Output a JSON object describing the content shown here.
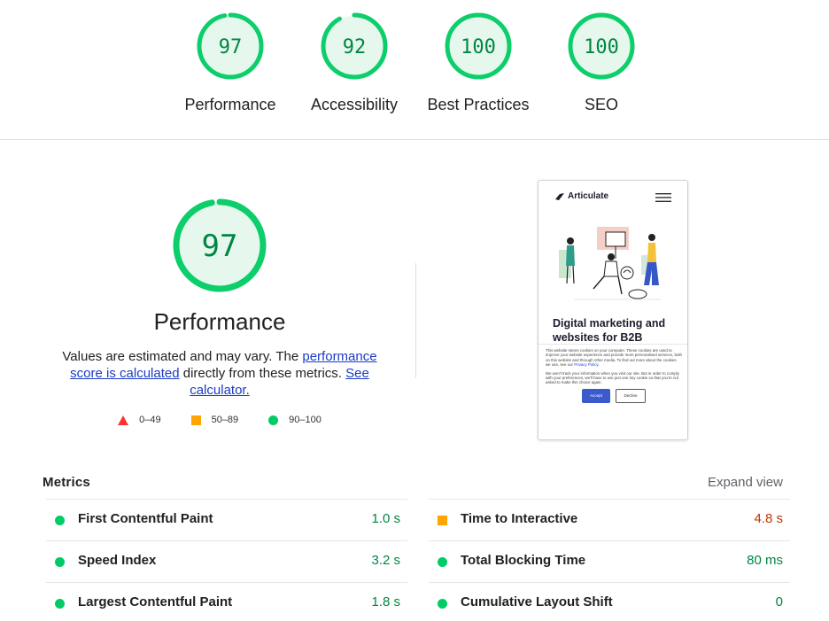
{
  "colors": {
    "pass": "#0cce6b",
    "pass_fill": "#e6f8ee",
    "average": "#ffa400",
    "fail": "#ff3333",
    "pass_text": "#018642",
    "average_text": "#c33300",
    "link": "#1a3cc5"
  },
  "gauges": [
    {
      "score": "97",
      "label": "Performance",
      "value": 0.97
    },
    {
      "score": "92",
      "label": "Accessibility",
      "value": 0.92
    },
    {
      "score": "100",
      "label": "Best Practices",
      "value": 1.0
    },
    {
      "score": "100",
      "label": "SEO",
      "value": 1.0
    }
  ],
  "performance": {
    "score": "97",
    "value": 0.97,
    "title": "Performance",
    "desc_prefix": "Values are estimated and may vary. The ",
    "link1": "performance score is calculated",
    "desc_middle": " directly from these metrics. ",
    "link2": "See calculator."
  },
  "legend": [
    {
      "icon": "triangle-icon",
      "range": "0–49"
    },
    {
      "icon": "square-icon",
      "range": "50–89"
    },
    {
      "icon": "circle-icon",
      "range": "90–100"
    }
  ],
  "screenshot": {
    "brand": "Articulate",
    "headline": "Digital marketing and websites for B2B",
    "cookie_text_1": "This website stores cookies on your computer. These cookies are used to improve your website experience and provide more personalised services, both on this website and through other media. To find out more about the cookies we use, see our",
    "privacy_link": "Privacy Policy.",
    "cookie_text_2": "We won't track your information when you visit our site. But in order to comply with your preferences, we'll have to use just one tiny cookie so that you're not asked to make this choice again.",
    "accept": "Accept",
    "decline": "Decline"
  },
  "metrics": {
    "title": "Metrics",
    "expand": "Expand view",
    "left": [
      {
        "name": "First Contentful Paint",
        "value": "1.0 s",
        "status": "pass"
      },
      {
        "name": "Speed Index",
        "value": "3.2 s",
        "status": "pass"
      },
      {
        "name": "Largest Contentful Paint",
        "value": "1.8 s",
        "status": "pass"
      }
    ],
    "right": [
      {
        "name": "Time to Interactive",
        "value": "4.8 s",
        "status": "average"
      },
      {
        "name": "Total Blocking Time",
        "value": "80 ms",
        "status": "pass"
      },
      {
        "name": "Cumulative Layout Shift",
        "value": "0",
        "status": "pass"
      }
    ]
  }
}
